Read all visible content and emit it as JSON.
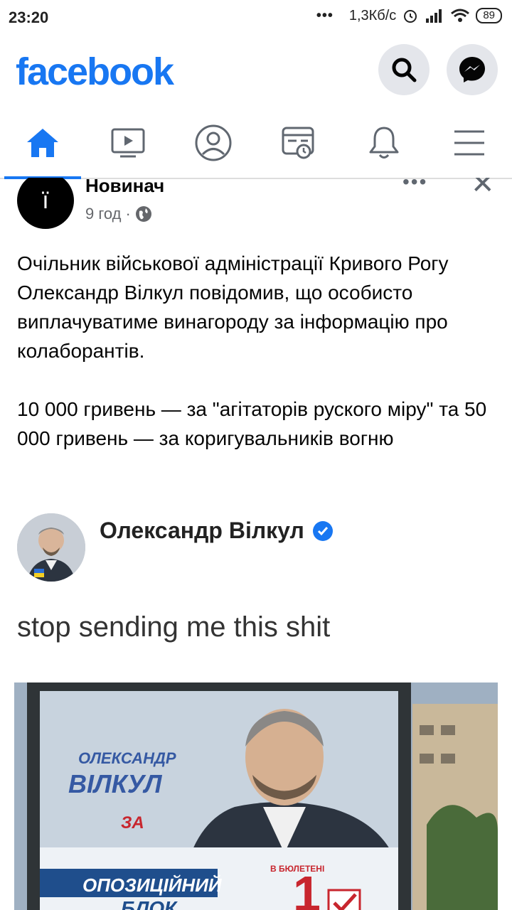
{
  "status_bar": {
    "time": "23:20",
    "dots": "•••",
    "speed": "1,3Кб/с",
    "battery": "89"
  },
  "app_bar": {
    "logo": "facebook"
  },
  "nav_tabs": [
    {
      "name": "home",
      "icon": "home-icon",
      "active": true
    },
    {
      "name": "watch",
      "icon": "video-icon",
      "active": false
    },
    {
      "name": "profile",
      "icon": "profile-icon",
      "active": false
    },
    {
      "name": "feeds",
      "icon": "feeds-icon",
      "active": false
    },
    {
      "name": "notifications",
      "icon": "bell-icon",
      "active": false
    },
    {
      "name": "menu",
      "icon": "menu-icon",
      "active": false
    }
  ],
  "post": {
    "author": "Новинач",
    "avatar_text": "ї",
    "time": "9 год",
    "separator": "·",
    "more": "•••",
    "close": "✕",
    "paragraph_1": "Очільник військової адміністрації Кривого Рогу Олександр Вілкул повідомив, що особисто виплачуватиме винагороду за інформацію про колаборантів.",
    "paragraph_2": "10 000 гривень — за \"агітаторів руского міру\" та 50 000 гривень — за коригувальників вогню"
  },
  "shared_image": {
    "name": "Олександр Вілкул",
    "caption": "stop sending me this shit",
    "billboard_name_1": "ОЛЕКСАНДР",
    "billboard_name_2": "ВІЛКУЛ",
    "billboard_za": "ЗА",
    "billboard_party": "ОПОЗИЦІЙНИЙ",
    "billboard_party_2": "БЛОК",
    "billboard_ballot": "В БЮЛЕТЕНІ",
    "billboard_number": "1"
  },
  "colors": {
    "brand": "#1877f2",
    "icon_gray": "#606770"
  }
}
